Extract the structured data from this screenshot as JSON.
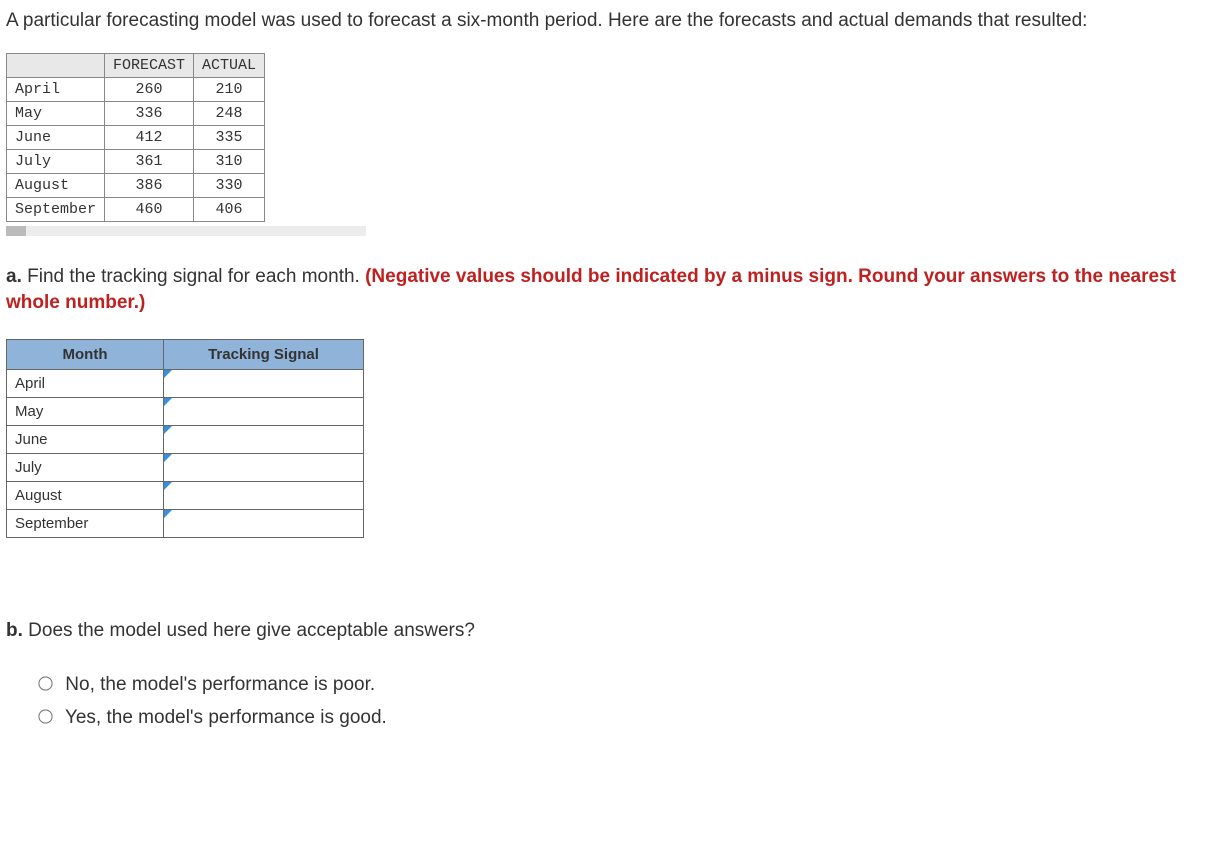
{
  "intro": "A particular forecasting model was used to forecast a six-month period. Here are the forecasts and actual demands that resulted:",
  "data_table": {
    "headers": [
      "",
      "FORECAST",
      "ACTUAL"
    ],
    "rows": [
      {
        "month": "April",
        "forecast": "260",
        "actual": "210"
      },
      {
        "month": "May",
        "forecast": "336",
        "actual": "248"
      },
      {
        "month": "June",
        "forecast": "412",
        "actual": "335"
      },
      {
        "month": "July",
        "forecast": "361",
        "actual": "310"
      },
      {
        "month": "August",
        "forecast": "386",
        "actual": "330"
      },
      {
        "month": "September",
        "forecast": "460",
        "actual": "406"
      }
    ]
  },
  "part_a": {
    "prefix": "a.",
    "text": " Find the tracking signal for each month. ",
    "note": "(Negative values should be indicated by a minus sign. Round your answers to the nearest whole number.)"
  },
  "answer_table": {
    "headers": [
      "Month",
      "Tracking Signal"
    ],
    "rows": [
      "April",
      "May",
      "June",
      "July",
      "August",
      "September"
    ]
  },
  "part_b": {
    "prefix": "b.",
    "text": " Does the model used here give acceptable answers?"
  },
  "options": [
    "No, the model's performance is poor.",
    "Yes, the model's performance is good."
  ]
}
